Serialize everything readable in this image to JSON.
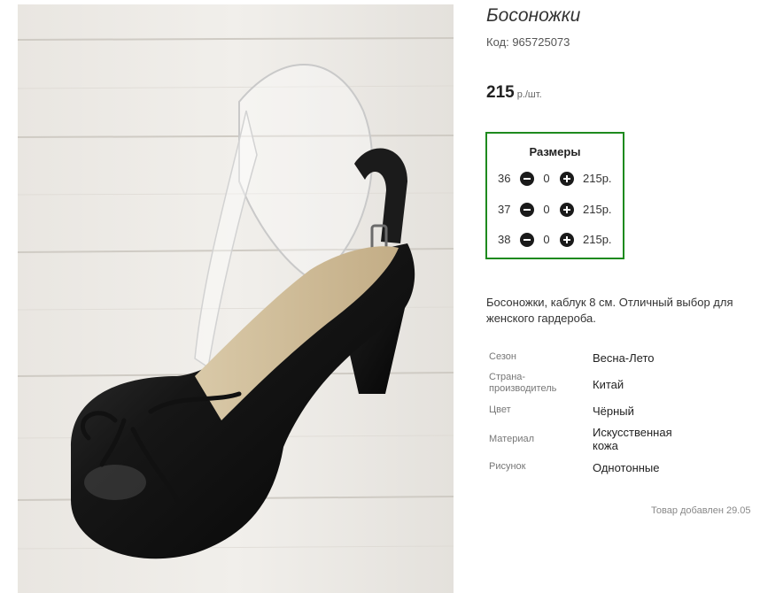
{
  "product": {
    "title": "Босоножки",
    "code": "Код: 965725073",
    "price": "215",
    "price_unit": "р./шт.",
    "image_alt": "black-slingback-heel-photo"
  },
  "sizes": {
    "header": "Размеры",
    "rows": [
      {
        "size": "36",
        "qty": "0",
        "price": "215р."
      },
      {
        "size": "37",
        "qty": "0",
        "price": "215р."
      },
      {
        "size": "38",
        "qty": "0",
        "price": "215р."
      }
    ]
  },
  "description": "Босоножки, каблук 8 см. Отличный выбор для женского гардероба.",
  "attributes": [
    {
      "key": "Сезон",
      "value": "Весна-Лето"
    },
    {
      "key": "Страна-производитель",
      "value": "Китай"
    },
    {
      "key": "Цвет",
      "value": "Чёрный"
    },
    {
      "key": "Материал",
      "value": "Искусственная кожа"
    },
    {
      "key": "Рисунок",
      "value": "Однотонные"
    }
  ],
  "added_text": "Товар добавлен 29.05",
  "colors": {
    "sizes_border": "#1e8a1e",
    "button": "#1a1a1a"
  }
}
